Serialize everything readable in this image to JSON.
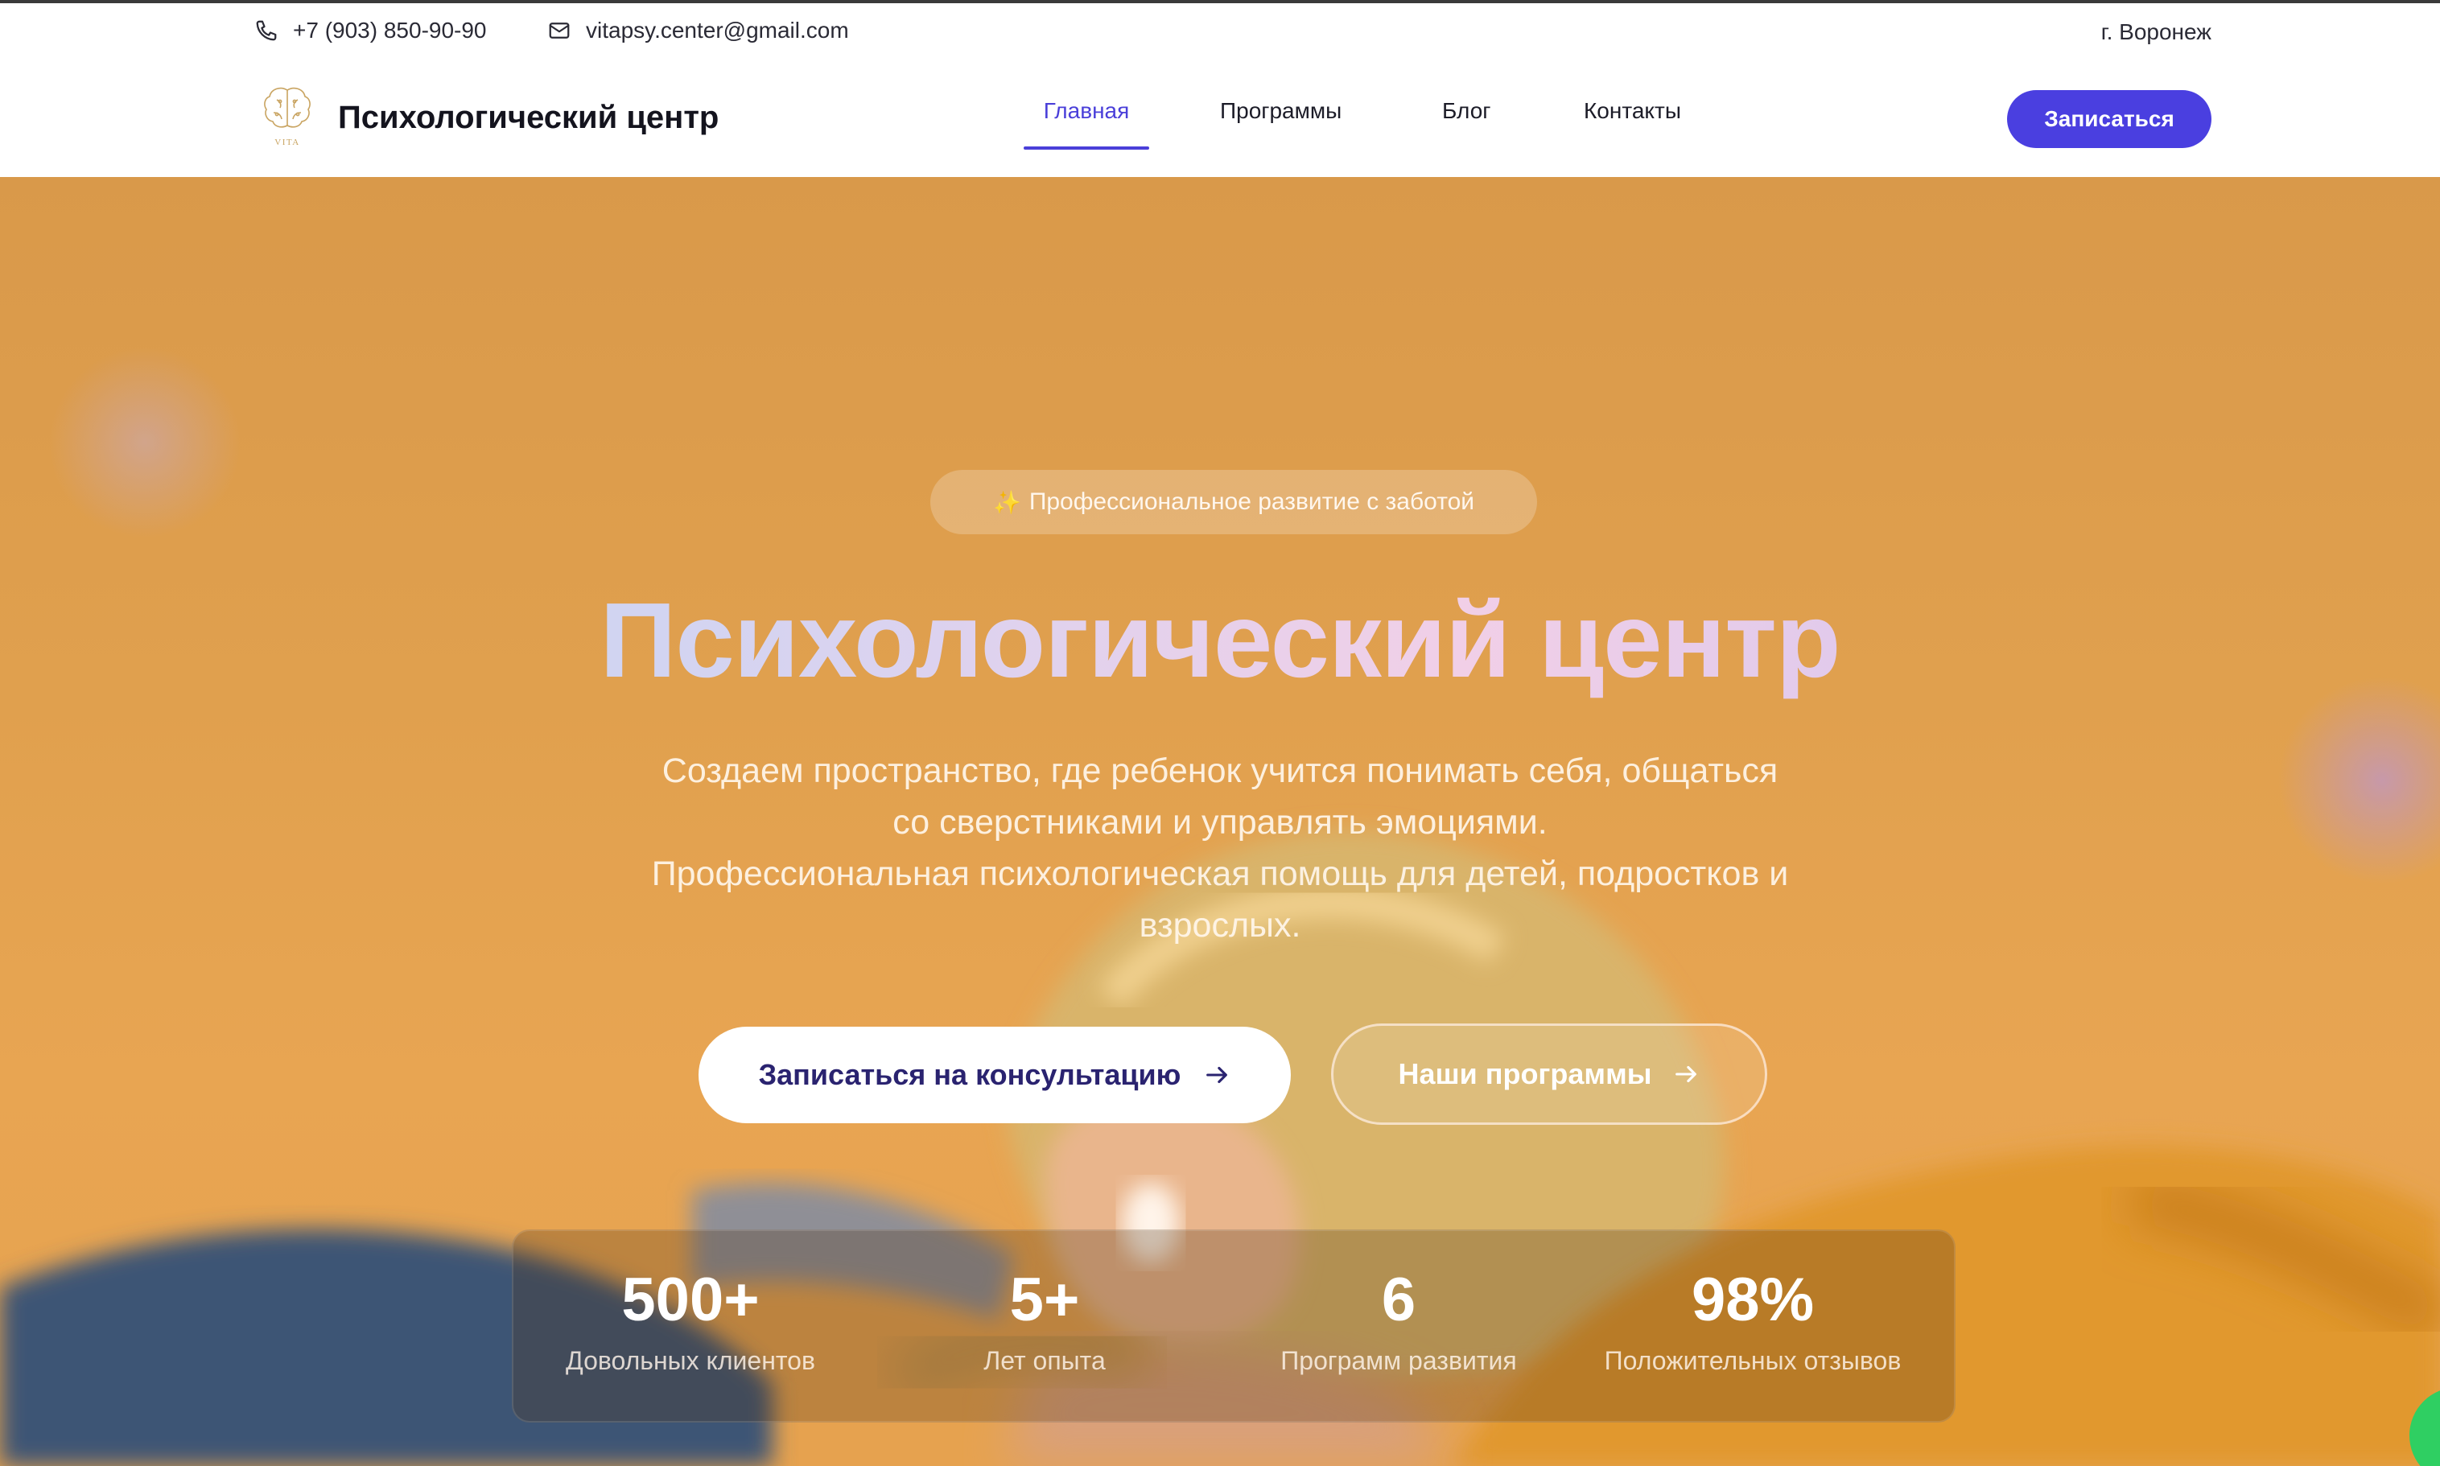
{
  "topbar": {
    "phone": "+7 (903) 850-90-90",
    "email": "vitapsy.center@gmail.com",
    "city": "г. Воронеж"
  },
  "header": {
    "logo_text": "VITA",
    "brand": "Психологический центр",
    "nav": [
      "Главная",
      "Программы",
      "Блог",
      "Контакты"
    ],
    "active_nav": "Главная",
    "cta": "Записаться"
  },
  "hero": {
    "badge": "Профессиональное развитие с заботой",
    "title": "Психологический центр",
    "subtitle_line1": "Создаем пространство, где ребенок учится понимать себя, общаться",
    "subtitle_line2": "со сверстниками и управлять эмоциями.",
    "subtitle_line3": "Профессиональная психологическая помощь для детей, подростков и",
    "subtitle_line4": "взрослых.",
    "primary_button": "Записаться на консультацию",
    "secondary_button": "Наши программы"
  },
  "stats": [
    {
      "value": "500+",
      "label": "Довольных клиентов"
    },
    {
      "value": "5+",
      "label": "Лет опыта"
    },
    {
      "value": "6",
      "label": "Программ развития"
    },
    {
      "value": "98%",
      "label": "Положительных отзывов"
    }
  ],
  "colors": {
    "accent": "#4a3fe0",
    "hero_bg": "#e0a04e",
    "title_gradient_start": "#bcd6f4",
    "title_gradient_end": "#c9c3f2"
  }
}
